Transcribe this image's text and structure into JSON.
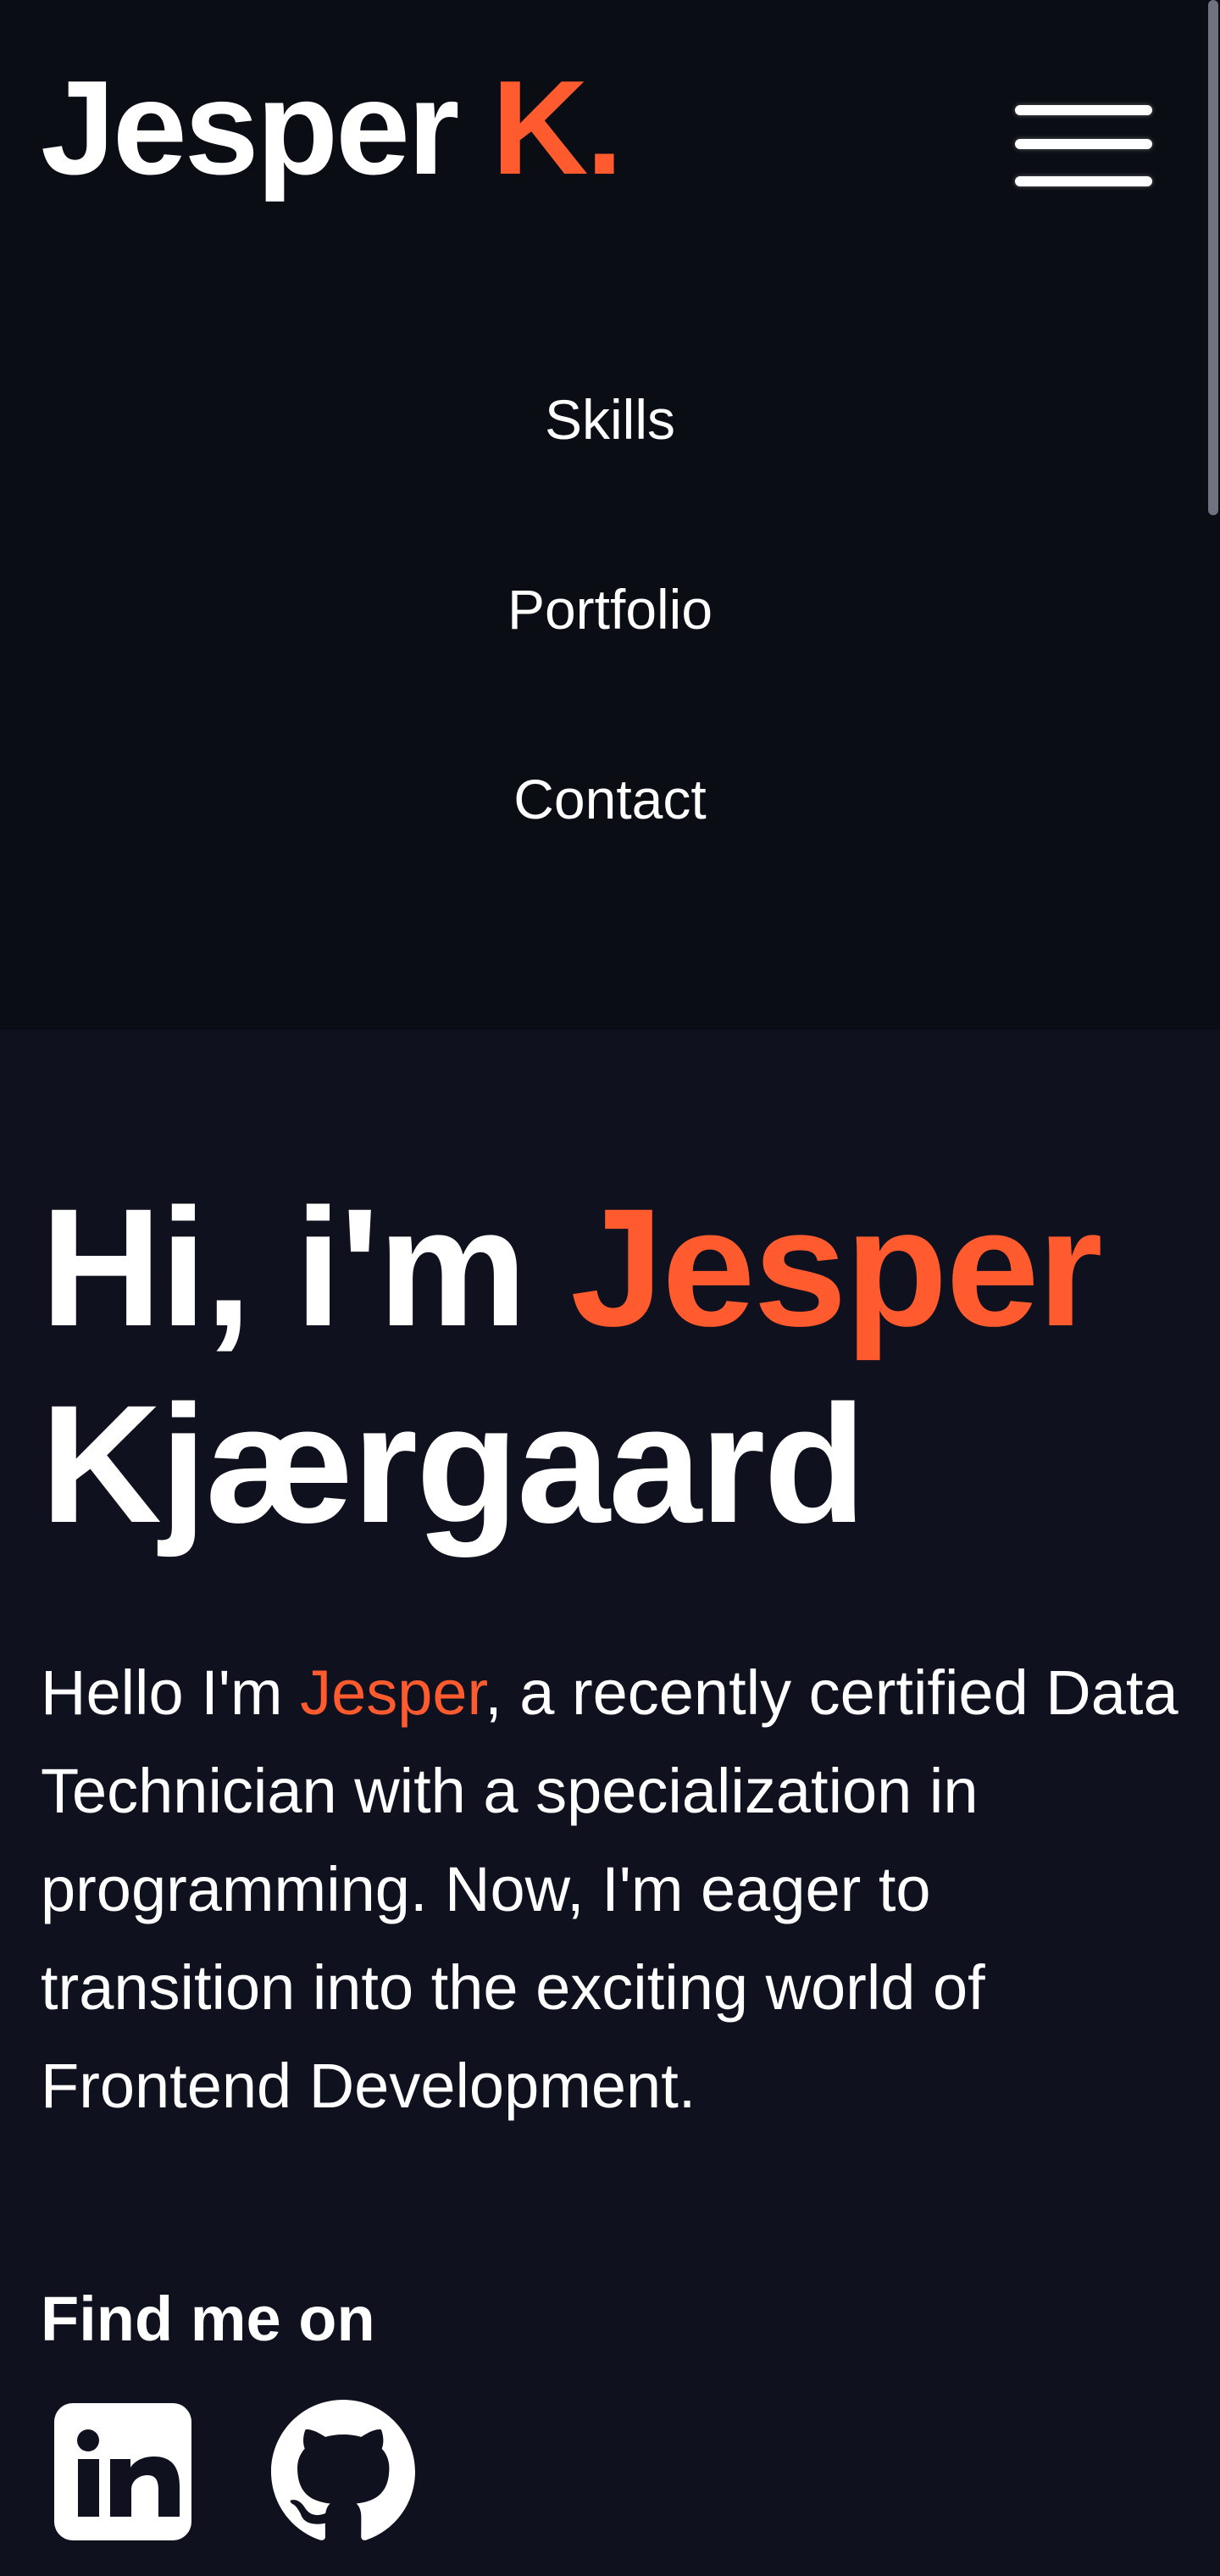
{
  "header": {
    "logo_name": "Jesper",
    "logo_initial": "K."
  },
  "nav": {
    "items": [
      {
        "label": "Skills"
      },
      {
        "label": "Portfolio"
      },
      {
        "label": "Contact"
      }
    ]
  },
  "hero": {
    "title_prefix": "Hi, i'm",
    "title_first_name": "Jesper",
    "title_last_name": "Kjærgaard",
    "intro_prefix": "Hello I'm",
    "intro_name": "Jesper",
    "intro_rest": ", a recently certified Data Technician with a specialization in programming. Now, I'm eager to transition into the exciting world of Frontend Development."
  },
  "social": {
    "heading": "Find me on",
    "links": [
      {
        "icon": "linkedin-icon"
      },
      {
        "icon": "github-icon"
      }
    ]
  },
  "colors": {
    "accent": "#ff5b2e",
    "background": "#0f111e",
    "header_background": "#0b0d15",
    "text": "#ffffff"
  }
}
